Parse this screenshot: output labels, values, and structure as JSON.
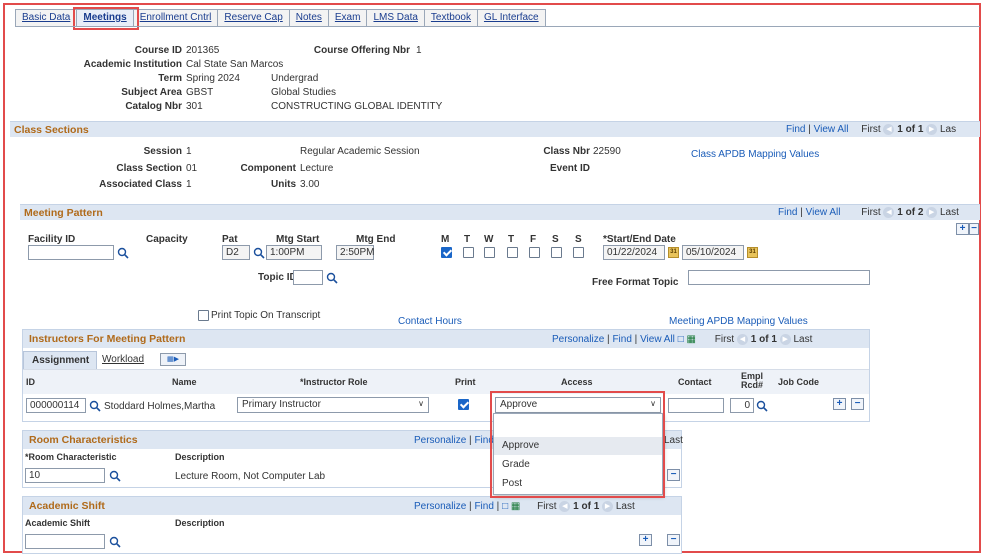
{
  "tabs": [
    "Basic Data",
    "Meetings",
    "Enrollment Cntrl",
    "Reserve Cap",
    "Notes",
    "Exam",
    "LMS Data",
    "Textbook",
    "GL Interface"
  ],
  "header": {
    "course_id_label": "Course ID",
    "course_id": "201365",
    "offering_label": "Course Offering Nbr",
    "offering": "1",
    "institution_label": "Academic Institution",
    "institution": "Cal State San Marcos",
    "term_label": "Term",
    "term": "Spring 2024",
    "career": "Undergrad",
    "subject_label": "Subject Area",
    "subject": "GBST",
    "subject_desc": "Global Studies",
    "catalog_label": "Catalog Nbr",
    "catalog": "301",
    "catalog_desc": "CONSTRUCTING GLOBAL IDENTITY"
  },
  "class_sections": {
    "title": "Class Sections",
    "nav": {
      "find": "Find",
      "sep": "|",
      "view_all": "View All",
      "first": "First",
      "count": "1 of 1",
      "last": "Las"
    },
    "session_label": "Session",
    "session": "1",
    "session_desc": "Regular Academic Session",
    "class_nbr_label": "Class Nbr",
    "class_nbr": "22590",
    "apdb_link": "Class APDB Mapping Values",
    "section_label": "Class Section",
    "section": "01",
    "component_label": "Component",
    "component": "Lecture",
    "event_label": "Event ID",
    "assoc_label": "Associated Class",
    "assoc": "1",
    "units_label": "Units",
    "units": "3.00"
  },
  "meeting_pattern": {
    "title": "Meeting Pattern",
    "nav": {
      "find": "Find",
      "sep": "|",
      "view_all": "View All",
      "first": "First",
      "count": "1 of 2",
      "last": "Last"
    },
    "facility_label": "Facility ID",
    "capacity_label": "Capacity",
    "pat_label": "Pat",
    "pat": "D2",
    "mtg_start_label": "Mtg Start",
    "mtg_start": "1:00PM",
    "mtg_end_label": "Mtg End",
    "mtg_end": "2:50PM",
    "days": [
      {
        "label": "M",
        "checked": true
      },
      {
        "label": "T",
        "checked": false
      },
      {
        "label": "W",
        "checked": false
      },
      {
        "label": "T",
        "checked": false
      },
      {
        "label": "F",
        "checked": false
      },
      {
        "label": "S",
        "checked": false
      },
      {
        "label": "S",
        "checked": false
      }
    ],
    "dates_label": "*Start/End Date",
    "start_date": "01/22/2024",
    "end_date": "05/10/2024",
    "topic_label": "Topic ID",
    "free_topic_label": "Free Format Topic",
    "print_topic_label": "Print Topic On Transcript",
    "contact_hours_link": "Contact Hours",
    "mtg_apdb_link": "Meeting APDB Mapping Values"
  },
  "instructors": {
    "title": "Instructors For Meeting Pattern",
    "nav": {
      "personalize": "Personalize",
      "sep": "|",
      "find": "Find",
      "view_all": "View All",
      "first": "First",
      "count": "1 of 1",
      "last": "Last"
    },
    "subtabs": [
      "Assignment",
      "Workload"
    ],
    "columns": [
      "ID",
      "Name",
      "*Instructor Role",
      "Print",
      "Access",
      "Contact",
      "Empl Rcd#",
      "Job Code"
    ],
    "row": {
      "id": "000000114",
      "name": "Stoddard Holmes,Martha",
      "role": "Primary Instructor",
      "print": true,
      "access": "Approve",
      "contact": "",
      "empl_rcd": "0"
    },
    "access_options": [
      "",
      "Approve",
      "Grade",
      "Post"
    ]
  },
  "room": {
    "title": "Room Characteristics",
    "nav": {
      "personalize": "Personalize",
      "sep": "|",
      "find": "Find",
      "last": "Last"
    },
    "columns": [
      "*Room Characteristic",
      "Description"
    ],
    "row": {
      "value": "10",
      "desc": "Lecture Room, Not Computer Lab"
    }
  },
  "shift": {
    "title": "Academic Shift",
    "nav": {
      "personalize": "Personalize",
      "sep": "|",
      "find": "Find",
      "first": "First",
      "count": "1 of 1",
      "last": "Last"
    },
    "columns": [
      "Academic Shift",
      "Description"
    ]
  },
  "icons": {
    "lookup": "magnifier-icon",
    "calendar": "calendar-icon",
    "add": "plus-icon",
    "remove": "minus-icon",
    "prev": "prev-arrow-icon",
    "next": "next-arrow-icon"
  },
  "colors": {
    "highlight": "#e24b4b",
    "section_title": "#b06a1a",
    "link": "#1a5cb8",
    "header_bg": "#dde6f2"
  }
}
